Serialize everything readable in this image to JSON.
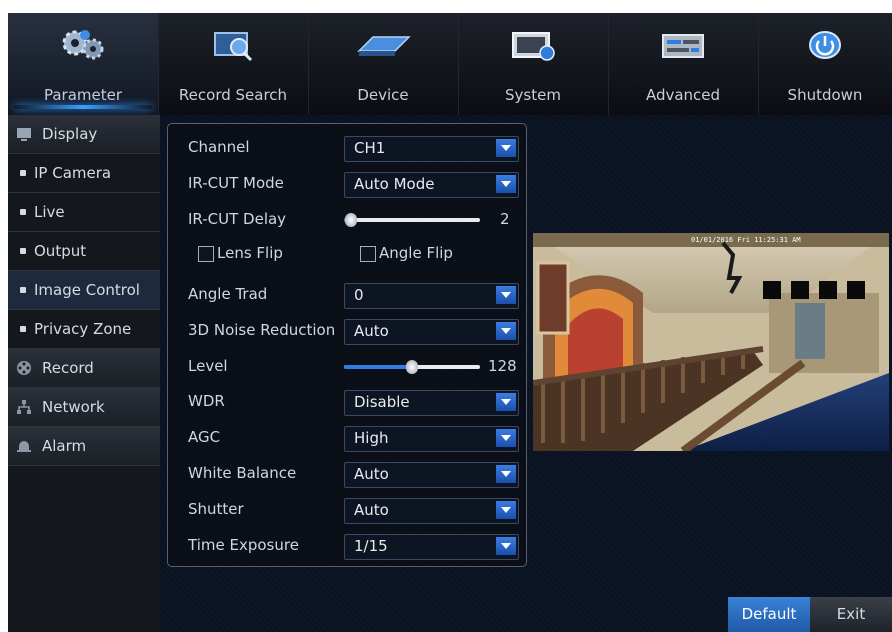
{
  "top_menu": [
    {
      "label": "Parameter",
      "icon": "gears-icon",
      "active": true
    },
    {
      "label": "Record Search",
      "icon": "record-search-icon",
      "active": false
    },
    {
      "label": "Device",
      "icon": "hard-drive-icon",
      "active": false
    },
    {
      "label": "System",
      "icon": "system-info-icon",
      "active": false
    },
    {
      "label": "Advanced",
      "icon": "advanced-icon",
      "active": false
    },
    {
      "label": "Shutdown",
      "icon": "power-icon",
      "active": false
    }
  ],
  "sidebar": {
    "display": "Display",
    "ip_camera": "IP Camera",
    "live": "Live",
    "output": "Output",
    "image_control": "Image Control",
    "privacy_zone": "Privacy Zone",
    "record": "Record",
    "network": "Network",
    "alarm": "Alarm"
  },
  "form": {
    "channel": {
      "label": "Channel",
      "value": "CH1"
    },
    "ircut_mode": {
      "label": "IR-CUT Mode",
      "value": "Auto Mode"
    },
    "ircut_delay": {
      "label": "IR-CUT Delay",
      "value": "2",
      "level": 0.05
    },
    "lens_flip": {
      "label": "Lens Flip",
      "checked": false
    },
    "angle_flip": {
      "label": "Angle Flip",
      "checked": false
    },
    "angle_trad": {
      "label": "Angle Trad",
      "value": "0"
    },
    "noise_reduction": {
      "label": "3D Noise Reduction",
      "value": "Auto"
    },
    "level": {
      "label": "Level",
      "value": "128",
      "level": 0.5
    },
    "wdr": {
      "label": "WDR",
      "value": "Disable"
    },
    "agc": {
      "label": "AGC",
      "value": "High"
    },
    "white_balance": {
      "label": "White Balance",
      "value": "Auto"
    },
    "shutter": {
      "label": "Shutter",
      "value": "Auto"
    },
    "time_exposure": {
      "label": "Time Exposure",
      "value": "1/15"
    }
  },
  "preview": {
    "timestamp": "01/01/2016 Fri 11:25:31 AM"
  },
  "buttons": {
    "default": "Default",
    "exit": "Exit"
  },
  "colors": {
    "accent": "#2f7de0",
    "background": "#05070c"
  }
}
